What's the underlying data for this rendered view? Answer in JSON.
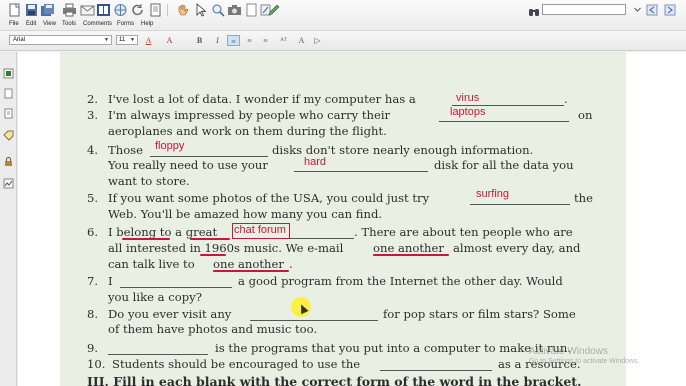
{
  "menu": {
    "items": [
      "File",
      "Edit",
      "View",
      "Tools",
      "Comments",
      "Forms",
      "Help"
    ]
  },
  "toolbar": {
    "icons": [
      "new-icon",
      "save-icon",
      "save-all-icon",
      "print-icon",
      "email-icon",
      "pages-icon",
      "globe-icon",
      "hand-tool-icon",
      "select-arrow-icon",
      "zoom-icon",
      "camera-icon",
      "page-icon",
      "extract-icon",
      "pen-icon"
    ],
    "search_placeholder": ""
  },
  "format": {
    "font": "Arial",
    "size": "11",
    "buttons": [
      "A",
      "A",
      "B",
      "I",
      "≡",
      "≡",
      "≡",
      "ᴬᵀ",
      "A"
    ]
  },
  "exercise": {
    "lines": [
      {
        "num": "2.",
        "text": "I've lost a lot of data. I wonder if my computer has a"
      },
      {
        "num": "3.",
        "text": "I'm always impressed by people who carry their"
      },
      {
        "num": "",
        "text": "aeroplanes and work on them during the flight."
      },
      {
        "num": "4.",
        "text": "Those"
      },
      {
        "num": "",
        "text": "You really need to use your"
      },
      {
        "num": "",
        "text": "want to store."
      },
      {
        "num": "5.",
        "text": "If you want some photos of the USA, you could just try"
      },
      {
        "num": "",
        "text": "Web. You'll be amazed how many you can find."
      },
      {
        "num": "6.",
        "text": "I belong to a great"
      },
      {
        "num": "",
        "text": "all interested in 1960s music. We e-mail"
      },
      {
        "num": "",
        "text": "can talk live to"
      },
      {
        "num": "7.",
        "text": "I"
      },
      {
        "num": "",
        "text": "you like a copy?"
      },
      {
        "num": "8.",
        "text": "Do you ever visit any"
      },
      {
        "num": "",
        "text": "of them have photos and music too."
      },
      {
        "num": "9.",
        "text": ""
      },
      {
        "num": "10.",
        "text": "Students should be encouraged to use the"
      }
    ],
    "tails": {
      "l2": ".",
      "l3": "on",
      "l4": "disks don't store nearly enough information.",
      "l4b": "disk for all the data you",
      "l5": "the",
      "l6": ". There are about ten people who are",
      "l6b_one_another": "one another",
      "l6b": "almost every day, and",
      "l6c_one_another": "one another",
      "l6c": ".",
      "l7": "a good program from the Internet the other day. Would",
      "l8": "for pop stars or film stars? Some",
      "l9": "is the programs that you put into a computer to make it run.",
      "l10": "as a resource."
    },
    "answers": {
      "virus": "virus",
      "laptops": "laptops",
      "floppy": "floppy",
      "hard": "hard",
      "surfing": "surfing",
      "chat_forum": "chat forum"
    },
    "heading": "III. Fill in each blank with the correct form of the word in the bracket."
  },
  "watermark": {
    "line1": "Activate Windows",
    "line2": "Go to Settings to activate Windows."
  },
  "colors": {
    "answer": "#c11a3a",
    "page": "#e9efe2"
  }
}
